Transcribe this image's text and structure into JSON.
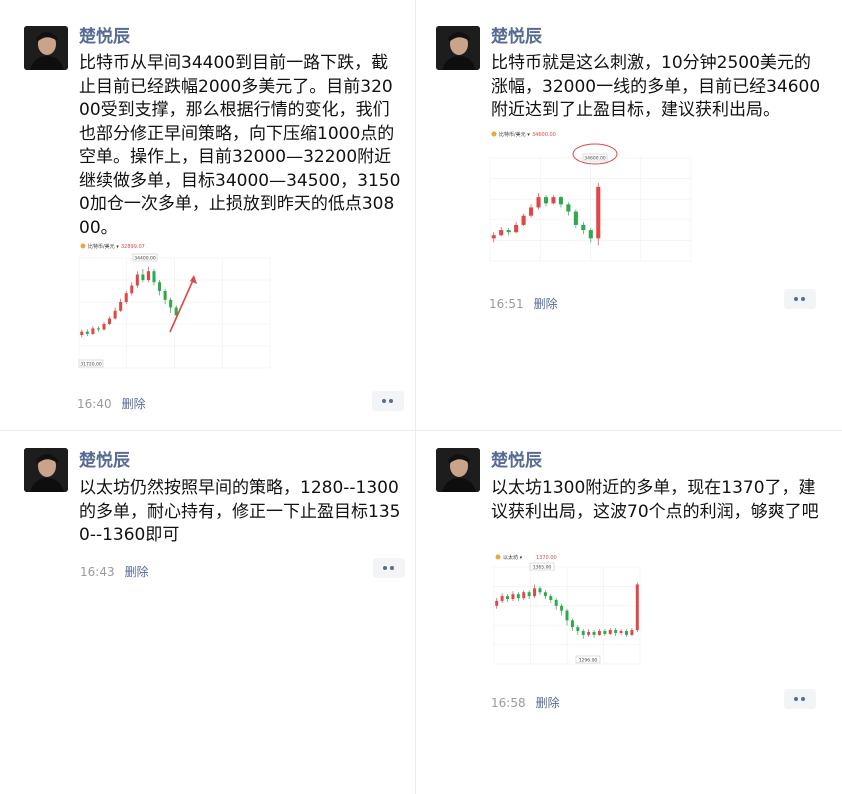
{
  "posts": [
    {
      "author": "楚悦辰",
      "text": "比特币从早间34400到目前一路下跌，截止目前已经跌幅2000多美元了。目前32000受到支撑，那么根据行情的变化，我们也部分修正早间策略，向下压缩1000点的空单。操作上，目前32000—32200附近继续做多单，目标34000—34500，31500加仓一次多单，止损放到昨天的低点30800。",
      "time": "16:40",
      "delete_label": "删除",
      "thumb": {
        "symbol": "比特币/美元",
        "price": "32899.07",
        "top_label": "34400.00",
        "bottom_label": "31720.00",
        "candles": [
          {
            "o": 30,
            "c": 33,
            "h": 35,
            "l": 28
          },
          {
            "o": 33,
            "c": 31,
            "h": 35,
            "l": 29
          },
          {
            "o": 31,
            "c": 36,
            "h": 38,
            "l": 30
          },
          {
            "o": 36,
            "c": 35,
            "h": 38,
            "l": 33
          },
          {
            "o": 35,
            "c": 40,
            "h": 42,
            "l": 34
          },
          {
            "o": 40,
            "c": 45,
            "h": 47,
            "l": 39
          },
          {
            "o": 45,
            "c": 52,
            "h": 55,
            "l": 44
          },
          {
            "o": 52,
            "c": 60,
            "h": 63,
            "l": 51
          },
          {
            "o": 60,
            "c": 68,
            "h": 70,
            "l": 58
          },
          {
            "o": 68,
            "c": 75,
            "h": 78,
            "l": 66
          },
          {
            "o": 75,
            "c": 85,
            "h": 88,
            "l": 73
          },
          {
            "o": 85,
            "c": 80,
            "h": 90,
            "l": 78
          },
          {
            "o": 80,
            "c": 88,
            "h": 92,
            "l": 78
          },
          {
            "o": 88,
            "c": 78,
            "h": 90,
            "l": 75
          },
          {
            "o": 78,
            "c": 70,
            "h": 80,
            "l": 66
          },
          {
            "o": 70,
            "c": 62,
            "h": 72,
            "l": 58
          },
          {
            "o": 62,
            "c": 55,
            "h": 64,
            "l": 50
          },
          {
            "o": 55,
            "c": 48,
            "h": 57,
            "l": 44
          }
        ]
      }
    },
    {
      "author": "楚悦辰",
      "text": "比特币就是这么刺激，10分钟2500美元的涨幅，32000一线的多单，目前已经34600附近达到了止盈目标，建议获利出局。",
      "time": "16:51",
      "delete_label": "删除",
      "thumb": {
        "symbol": "比特币/美元",
        "price": "34600.00",
        "top_label": "34600.00",
        "candles": [
          {
            "o": 22,
            "c": 25,
            "h": 28,
            "l": 18
          },
          {
            "o": 25,
            "c": 30,
            "h": 33,
            "l": 24
          },
          {
            "o": 30,
            "c": 28,
            "h": 32,
            "l": 25
          },
          {
            "o": 28,
            "c": 35,
            "h": 38,
            "l": 27
          },
          {
            "o": 35,
            "c": 44,
            "h": 46,
            "l": 34
          },
          {
            "o": 44,
            "c": 52,
            "h": 55,
            "l": 42
          },
          {
            "o": 52,
            "c": 62,
            "h": 66,
            "l": 50
          },
          {
            "o": 62,
            "c": 56,
            "h": 64,
            "l": 53
          },
          {
            "o": 56,
            "c": 62,
            "h": 64,
            "l": 55
          },
          {
            "o": 62,
            "c": 55,
            "h": 63,
            "l": 52
          },
          {
            "o": 55,
            "c": 48,
            "h": 57,
            "l": 44
          },
          {
            "o": 48,
            "c": 35,
            "h": 50,
            "l": 32
          },
          {
            "o": 35,
            "c": 30,
            "h": 38,
            "l": 26
          },
          {
            "o": 30,
            "c": 22,
            "h": 32,
            "l": 18
          },
          {
            "o": 22,
            "c": 72,
            "h": 76,
            "l": 15
          }
        ]
      }
    },
    {
      "author": "楚悦辰",
      "text": "以太坊仍然按照早间的策略，1280--1300的多单，耐心持有，修正一下止盈目标1350--1360即可",
      "time": "16:43",
      "delete_label": "删除"
    },
    {
      "author": "楚悦辰",
      "text": "以太坊1300附近的多单，现在1370了，建议获利出局，这波70个点的利润，够爽了吧",
      "time": "16:58",
      "delete_label": "删除",
      "thumb": {
        "symbol": "以太坊",
        "price": "1370.00",
        "top_label": "1365.00",
        "bottom_label": "1296.00",
        "candles": [
          {
            "o": 60,
            "c": 65,
            "h": 68,
            "l": 57
          },
          {
            "o": 65,
            "c": 70,
            "h": 73,
            "l": 63
          },
          {
            "o": 70,
            "c": 67,
            "h": 72,
            "l": 64
          },
          {
            "o": 67,
            "c": 72,
            "h": 75,
            "l": 65
          },
          {
            "o": 72,
            "c": 68,
            "h": 74,
            "l": 65
          },
          {
            "o": 68,
            "c": 74,
            "h": 76,
            "l": 66
          },
          {
            "o": 74,
            "c": 70,
            "h": 76,
            "l": 67
          },
          {
            "o": 70,
            "c": 78,
            "h": 82,
            "l": 68
          },
          {
            "o": 78,
            "c": 74,
            "h": 80,
            "l": 71
          },
          {
            "o": 74,
            "c": 70,
            "h": 76,
            "l": 67
          },
          {
            "o": 70,
            "c": 66,
            "h": 72,
            "l": 63
          },
          {
            "o": 66,
            "c": 60,
            "h": 68,
            "l": 56
          },
          {
            "o": 60,
            "c": 55,
            "h": 62,
            "l": 50
          },
          {
            "o": 55,
            "c": 45,
            "h": 57,
            "l": 40
          },
          {
            "o": 45,
            "c": 38,
            "h": 47,
            "l": 34
          },
          {
            "o": 38,
            "c": 34,
            "h": 40,
            "l": 30
          },
          {
            "o": 34,
            "c": 30,
            "h": 36,
            "l": 26
          },
          {
            "o": 30,
            "c": 33,
            "h": 36,
            "l": 28
          },
          {
            "o": 33,
            "c": 30,
            "h": 35,
            "l": 27
          },
          {
            "o": 30,
            "c": 34,
            "h": 36,
            "l": 29
          },
          {
            "o": 34,
            "c": 31,
            "h": 36,
            "l": 29
          },
          {
            "o": 31,
            "c": 35,
            "h": 37,
            "l": 30
          },
          {
            "o": 35,
            "c": 32,
            "h": 37,
            "l": 29
          },
          {
            "o": 32,
            "c": 34,
            "h": 36,
            "l": 30
          },
          {
            "o": 34,
            "c": 30,
            "h": 36,
            "l": 28
          },
          {
            "o": 30,
            "c": 35,
            "h": 37,
            "l": 29
          },
          {
            "o": 35,
            "c": 82,
            "h": 84,
            "l": 33
          }
        ]
      }
    }
  ],
  "colors": {
    "up": "#e04848",
    "down": "#2fa84f",
    "name": "#576b95"
  }
}
